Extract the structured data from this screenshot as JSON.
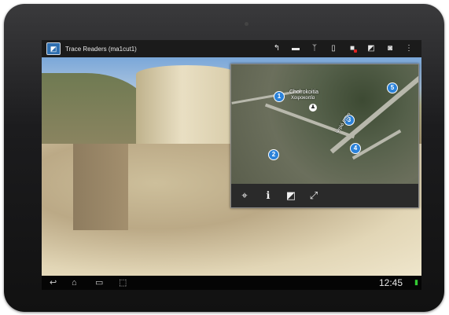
{
  "app": {
    "title": "Trace Readers (ma1cut1)",
    "icon": "map-app-icon"
  },
  "toolbar": {
    "actions": [
      {
        "name": "route-icon",
        "glyph": "↰"
      },
      {
        "name": "folder-icon",
        "glyph": "▬"
      },
      {
        "name": "antenna-icon",
        "glyph": "ᛉ"
      },
      {
        "name": "clipboard-icon",
        "glyph": "▯"
      },
      {
        "name": "marker-flag-icon",
        "glyph": "■"
      },
      {
        "name": "map-view-icon",
        "glyph": "◩"
      },
      {
        "name": "camera-icon",
        "glyph": "◙"
      },
      {
        "name": "overflow-menu-icon",
        "glyph": "⋮"
      }
    ]
  },
  "map": {
    "place_label": "Choirokoitia",
    "place_label_local": "Χοιροκοιτία",
    "road_label": "Ψηλό Εργο",
    "pins": [
      "1",
      "2",
      "3",
      "4",
      "5"
    ],
    "controls": [
      {
        "name": "locate-icon",
        "glyph": "⌖"
      },
      {
        "name": "info-icon",
        "glyph": "ℹ"
      },
      {
        "name": "map-layer-icon",
        "glyph": "◩"
      },
      {
        "name": "fullscreen-icon",
        "glyph": "⤢"
      }
    ]
  },
  "status": {
    "time": "12:45"
  },
  "navbar": {
    "buttons": [
      {
        "name": "back-icon",
        "glyph": "↩"
      },
      {
        "name": "home-icon",
        "glyph": "⌂"
      },
      {
        "name": "recent-apps-icon",
        "glyph": "▭"
      },
      {
        "name": "screenshot-icon",
        "glyph": "⬚"
      }
    ]
  }
}
